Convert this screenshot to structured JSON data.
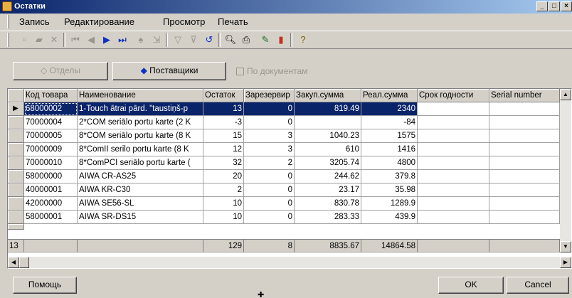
{
  "window": {
    "title": "Остатки",
    "min": "_",
    "max": "□",
    "close": "×"
  },
  "menu": [
    "Запись",
    "Редактирование",
    "Просмотр",
    "Печать"
  ],
  "toolbar_icons": [
    "new-icon",
    "open-icon",
    "delete-icon",
    "first-record-icon",
    "prev-record-icon",
    "next-record-icon",
    "last-record-icon",
    "find-icon",
    "find-next-icon",
    "filter-icon",
    "clear-filter-icon",
    "refresh-icon",
    "preview-icon",
    "print-icon",
    "edit-chart-icon",
    "chart-icon",
    "help-icon"
  ],
  "buttons": {
    "departments": "Отделы",
    "suppliers": "Поставщики",
    "by_documents": "По документам"
  },
  "columns": [
    "Код товара",
    "Наименование",
    "Остаток",
    "Зарезервир",
    "Закуп.сумма",
    "Реал.сумма",
    "Срок годности",
    "Serial number"
  ],
  "rows": [
    [
      "68000002",
      "1-Touch ātrai pārd. \"taustiņš-p",
      "13",
      "0",
      "819.49",
      "2340",
      "",
      ""
    ],
    [
      "70000004",
      "2*COM seriālo portu karte (2 K",
      "-3",
      "0",
      "",
      "-84",
      "",
      ""
    ],
    [
      "70000005",
      "8*COM seriālo portu karte (8 K",
      "15",
      "3",
      "1040.23",
      "1575",
      "",
      ""
    ],
    [
      "70000009",
      "8*ComII serilo portu karte (8 K",
      "12",
      "3",
      "610",
      "1416",
      "",
      ""
    ],
    [
      "70000010",
      "8*ComPCI seriālo portu karte (",
      "32",
      "2",
      "3205.74",
      "4800",
      "",
      ""
    ],
    [
      "58000000",
      "AIWA CR-AS25",
      "20",
      "0",
      "244.62",
      "379.8",
      "",
      ""
    ],
    [
      "40000001",
      "AIWA KR-C30",
      "2",
      "0",
      "23.17",
      "35.98",
      "",
      ""
    ],
    [
      "42000000",
      "AIWA SE56-SL",
      "10",
      "0",
      "830.78",
      "1289.9",
      "",
      ""
    ],
    [
      "58000001",
      "AIWA SR-DS15",
      "10",
      "0",
      "283.33",
      "439.9",
      "",
      ""
    ]
  ],
  "footer": {
    "count": "13",
    "ostatok": "129",
    "reserved": "8",
    "purchase": "8835.67",
    "sales": "14864.58"
  },
  "bottom": {
    "help": "Помощь",
    "ok": "OK",
    "cancel": "Cancel"
  },
  "colors": {
    "title": "#0a246a",
    "selection": "#0a246a",
    "face": "#d4d0c8"
  }
}
